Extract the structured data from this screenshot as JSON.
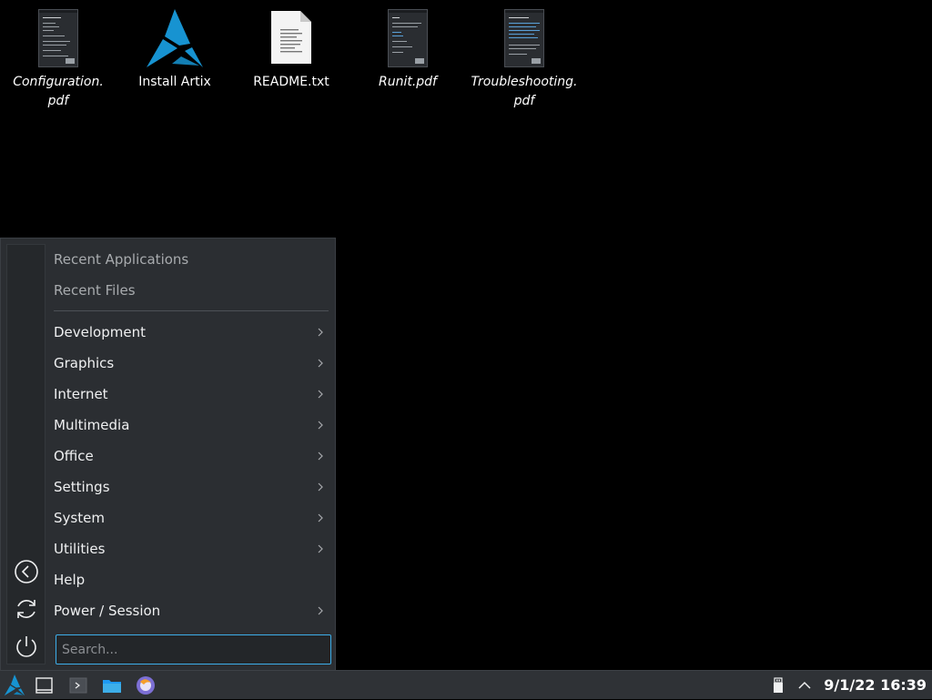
{
  "desktop": {
    "icons": [
      {
        "label": "Configuration.\npdf",
        "kind": "pdf",
        "italic": true
      },
      {
        "label": "Install Artix",
        "kind": "artix",
        "italic": false
      },
      {
        "label": "README.txt",
        "kind": "txt",
        "italic": false
      },
      {
        "label": "Runit.pdf",
        "kind": "pdf",
        "italic": true
      },
      {
        "label": "Troubleshooting.\npdf",
        "kind": "pdf",
        "italic": true
      }
    ]
  },
  "menu": {
    "recent": [
      {
        "label": "Recent Applications"
      },
      {
        "label": "Recent Files"
      }
    ],
    "items": [
      {
        "label": "Development",
        "submenu": true
      },
      {
        "label": "Graphics",
        "submenu": true
      },
      {
        "label": "Internet",
        "submenu": true
      },
      {
        "label": "Multimedia",
        "submenu": true
      },
      {
        "label": "Office",
        "submenu": true
      },
      {
        "label": "Settings",
        "submenu": true
      },
      {
        "label": "System",
        "submenu": true
      },
      {
        "label": "Utilities",
        "submenu": true
      },
      {
        "label": "Help",
        "submenu": false
      },
      {
        "label": "Power / Session",
        "submenu": true
      }
    ],
    "side_buttons": [
      "back-icon",
      "refresh-icon",
      "power-icon"
    ],
    "search": {
      "placeholder": "Search...",
      "value": ""
    }
  },
  "taskbar": {
    "buttons": [
      "artix-launcher-icon",
      "show-desktop-icon",
      "terminal-icon",
      "file-manager-icon",
      "browser-icon"
    ],
    "tray": [
      "removable-device-icon",
      "tray-expand-icon"
    ],
    "clock": "9/1/22 16:39"
  },
  "colors": {
    "accent": "#3daee9",
    "artix_blue": "#1793d1",
    "menu_bg": "#2b2e32",
    "taskbar_bg": "#2f3236"
  }
}
